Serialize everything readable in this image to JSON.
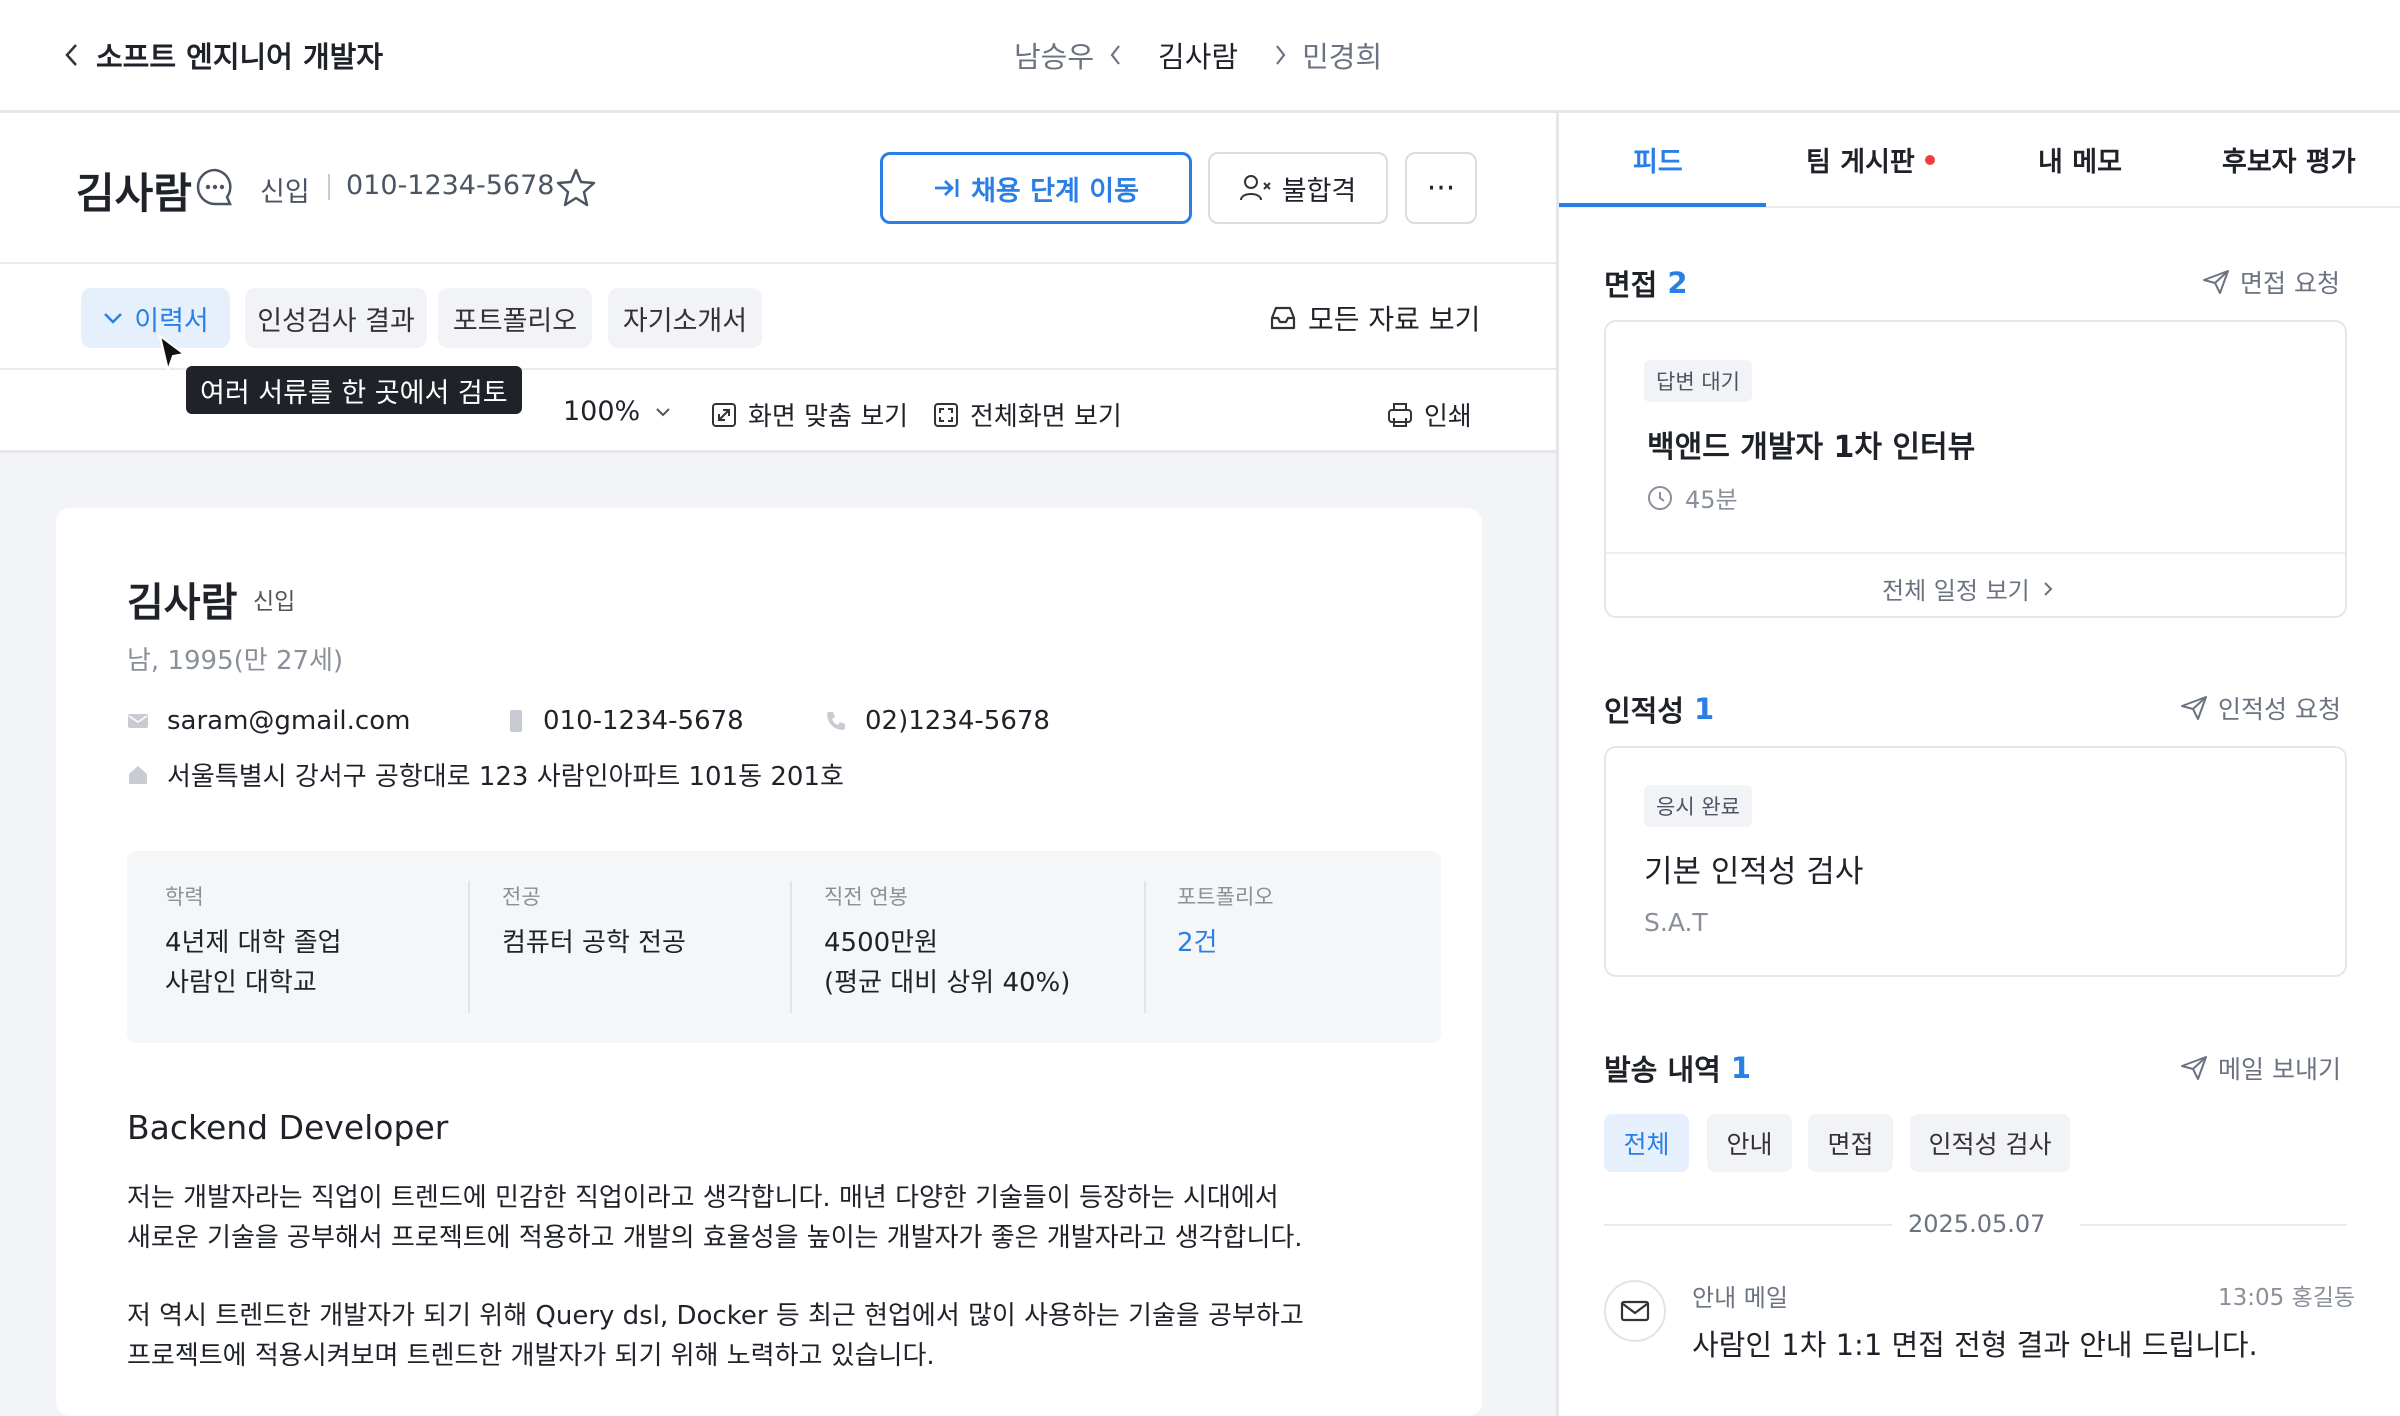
{
  "header": {
    "back_title": "소프트 엔지니어 개발자",
    "prev_candidate": "남승우",
    "current_candidate": "김사람",
    "next_candidate": "민경희"
  },
  "candidate": {
    "name": "김사람",
    "level": "신입",
    "phone": "010-1234-5678"
  },
  "actions": {
    "move_stage": "채용 단계 이동",
    "reject": "불합격",
    "more": "···"
  },
  "doc_tabs": [
    "이력서",
    "인성검사 결과",
    "포트폴리오",
    "자기소개서"
  ],
  "all_docs": "모든 자료 보기",
  "tooltip": "여러 서류를 한 곳에서 검토",
  "viewer": {
    "zoom": "100%",
    "fit": "화면 맞춤 보기",
    "fullscreen": "전체화면 보기",
    "print": "인쇄"
  },
  "resume": {
    "name": "김사람",
    "level": "신입",
    "birth": "남, 1995(만 27세)",
    "email": "saram@gmail.com",
    "mobile": "010-1234-5678",
    "tel": "02)1234-5678",
    "address": "서울특별시 강서구 공항대로 123 사람인아파트 101동 201호",
    "summary": [
      {
        "label": "학력",
        "line1": "4년제 대학 졸업",
        "line2": "사람인 대학교"
      },
      {
        "label": "전공",
        "line1": "컴퓨터 공학 전공",
        "line2": ""
      },
      {
        "label": "직전 연봉",
        "line1": "4500만원",
        "line2": "(평균 대비 상위 40%)"
      },
      {
        "label": "포트폴리오",
        "line1": "2건",
        "line2": ""
      }
    ],
    "heading": "Backend Developer",
    "para1_l1": "저는 개발자라는 직업이 트렌드에 민감한 직업이라고 생각합니다. 매년 다양한 기술들이 등장하는 시대에서",
    "para1_l2": "새로운 기술을 공부해서 프로젝트에 적용하고 개발의 효율성을 높이는 개발자가 좋은 개발자라고 생각합니다.",
    "para2_l1": "저 역시 트렌드한 개발자가 되기 위해 Query dsl, Docker 등 최근 현업에서 많이 사용하는 기술을 공부하고",
    "para2_l2": "프로젝트에 적용시켜보며 트렌드한 개발자가 되기 위해 노력하고 있습니다."
  },
  "right_tabs": [
    "피드",
    "팀 게시판",
    "내 메모",
    "후보자 평가"
  ],
  "interview": {
    "title": "면접",
    "count": "2",
    "action": "면접 요청",
    "badge": "답변 대기",
    "name": "백앤드 개발자 1차 인터뷰",
    "duration": "45분",
    "view_all": "전체 일정 보기"
  },
  "aptitude": {
    "title": "인적성",
    "count": "1",
    "action": "인적성 요청",
    "badge": "응시 완료",
    "name": "기본 인적성 검사",
    "code": "S.A.T"
  },
  "history": {
    "title": "발송 내역",
    "count": "1",
    "action": "메일 보내기",
    "chips": [
      "전체",
      "안내",
      "면접",
      "인적성 검사"
    ],
    "date": "2025.05.07",
    "mail_type": "안내 메일",
    "mail_meta": "13:05 홍길동",
    "mail_subject": "사람인 1차 1:1 면접 전형 결과 안내 드립니다."
  },
  "colors": {
    "accent": "#2a7fe6",
    "notify_dot": "#f03e3e",
    "doc_bg": "#f3f4f7"
  }
}
